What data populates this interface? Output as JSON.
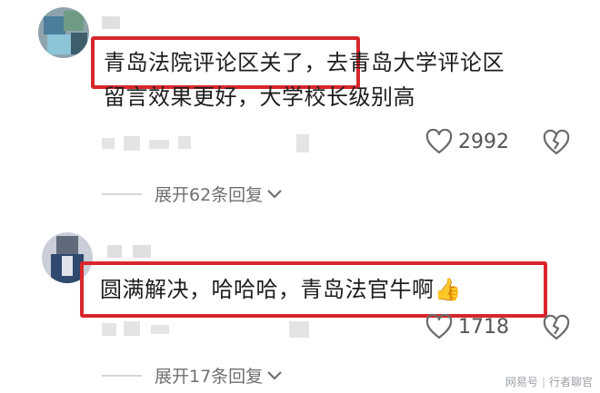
{
  "comments": [
    {
      "text_line1": "青岛法院评论区关了，去青岛大学评论区",
      "text_line2": "留言效果更好，大学校长级别高",
      "likes": "2992",
      "expand_label": "展开62条回复"
    },
    {
      "text_line1": "圆满解决，哈哈哈，青岛法官牛啊",
      "emoji": "👍",
      "likes": "1718",
      "expand_label": "展开17条回复"
    }
  ],
  "watermark": {
    "source": "网易号",
    "author": "行者聊官"
  },
  "colors": {
    "highlight": "#d8262b",
    "like_icon": "#6b6b6b",
    "expand_text": "#6f6f6f"
  },
  "icons": [
    "heart-outline-icon",
    "broken-heart-icon",
    "chevron-down-icon",
    "thumbs-up-emoji"
  ]
}
